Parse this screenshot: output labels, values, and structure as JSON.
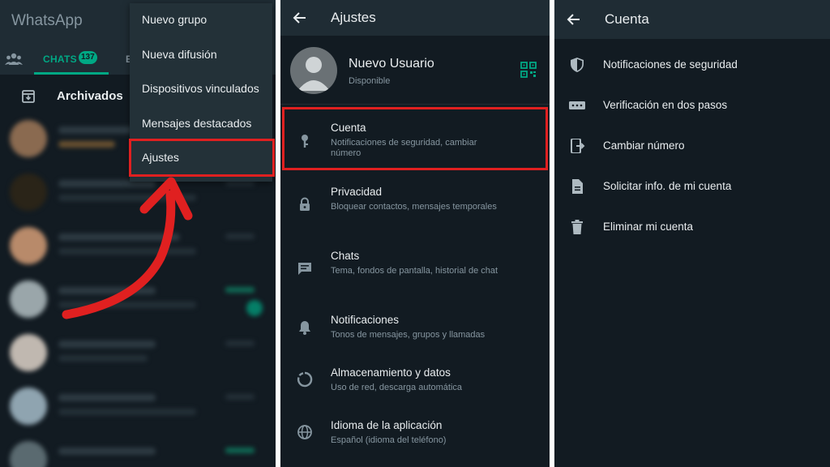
{
  "colors": {
    "background": "#121b22",
    "header": "#1f2c34",
    "accent": "#00a884",
    "highlight": "#e02020",
    "text_primary": "#e9edef",
    "text_secondary": "#8696a0"
  },
  "panel_left": {
    "app_title": "WhatsApp",
    "tabs": [
      {
        "label": "CHATS",
        "badge": "137",
        "icon": "community-icon"
      },
      {
        "label": "E"
      }
    ],
    "archived_label": "Archivados",
    "overflow_menu": [
      {
        "label": "Nuevo grupo"
      },
      {
        "label": "Nueva difusión"
      },
      {
        "label": "Dispositivos vinculados"
      },
      {
        "label": "Mensajes destacados"
      },
      {
        "label": "Ajustes",
        "highlighted": true
      }
    ]
  },
  "panel_middle": {
    "title": "Ajustes",
    "profile": {
      "name": "Nuevo Usuario",
      "status": "Disponible",
      "qr_icon": "qr-code-icon"
    },
    "items": [
      {
        "title": "Cuenta",
        "subtitle": "Notificaciones de seguridad, cambiar número",
        "icon": "key-icon",
        "highlighted": true
      },
      {
        "title": "Privacidad",
        "subtitle": "Bloquear contactos, mensajes temporales",
        "icon": "lock-icon"
      },
      {
        "title": "Chats",
        "subtitle": "Tema, fondos de pantalla, historial de chat",
        "icon": "chat-icon"
      },
      {
        "title": "Notificaciones",
        "subtitle": "Tonos de mensajes, grupos y llamadas",
        "icon": "bell-icon"
      },
      {
        "title": "Almacenamiento y datos",
        "subtitle": "Uso de red, descarga automática",
        "icon": "storage-icon"
      },
      {
        "title": "Idioma de la aplicación",
        "subtitle": "Español (idioma del teléfono)",
        "icon": "globe-icon"
      }
    ]
  },
  "panel_right": {
    "title": "Cuenta",
    "items": [
      {
        "label": "Notificaciones de seguridad",
        "icon": "shield-icon"
      },
      {
        "label": "Verificación en dos pasos",
        "icon": "dots-icon"
      },
      {
        "label": "Cambiar número",
        "icon": "phone-transfer-icon"
      },
      {
        "label": "Solicitar info. de mi cuenta",
        "icon": "document-icon"
      },
      {
        "label": "Eliminar mi cuenta",
        "icon": "trash-icon"
      }
    ]
  }
}
